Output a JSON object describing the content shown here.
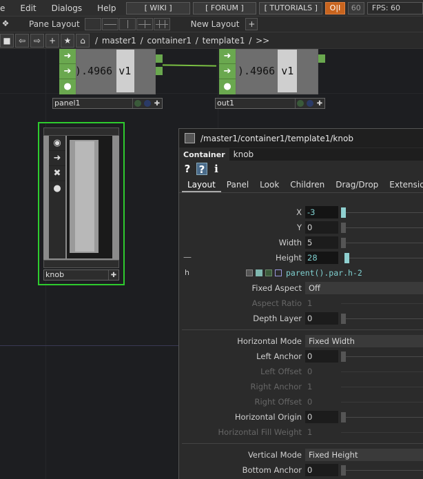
{
  "menubar": {
    "items": [
      "e",
      "Edit",
      "Dialogs",
      "Help"
    ],
    "wiki": "[ WIKI ]",
    "forum": "[ FORUM ]",
    "tutorials": "[ TUTORIALS ]",
    "oi": "O|I",
    "fps_cap": "60",
    "fps": "FPS:  60"
  },
  "panebar": {
    "pane_layout": "Pane Layout",
    "new_layout": "New Layout",
    "plus": "+"
  },
  "pathbar": {
    "path": "/ master1 / container1 / template1 / >>"
  },
  "nodes": {
    "panel1": {
      "name": "panel1",
      "value": ").4966 v1"
    },
    "out1": {
      "name": "out1",
      "value": ").4966 v1"
    },
    "knob": {
      "name": "knob"
    }
  },
  "param_panel": {
    "title": "/master1/container1/template1/knob",
    "type": "Container",
    "op_name": "knob",
    "help": [
      "?",
      "?",
      "i"
    ],
    "tabs": [
      "Layout",
      "Panel",
      "Look",
      "Children",
      "Drag/Drop",
      "Extensions"
    ],
    "params": {
      "x": {
        "label": "X",
        "value": "-3"
      },
      "y": {
        "label": "Y",
        "value": "0"
      },
      "width": {
        "label": "Width",
        "value": "5"
      },
      "height": {
        "label": "Height",
        "value": "28"
      },
      "h_expr_label": "h",
      "h_expr": "parent().par.h-2",
      "fixed_aspect": {
        "label": "Fixed Aspect",
        "value": "Off"
      },
      "aspect_ratio": {
        "label": "Aspect Ratio",
        "value": "1"
      },
      "depth_layer": {
        "label": "Depth Layer",
        "value": "0"
      },
      "horizontal_mode": {
        "label": "Horizontal Mode",
        "value": "Fixed Width"
      },
      "left_anchor": {
        "label": "Left Anchor",
        "value": "0"
      },
      "left_offset": {
        "label": "Left Offset",
        "value": "0"
      },
      "right_anchor": {
        "label": "Right Anchor",
        "value": "1"
      },
      "right_offset": {
        "label": "Right Offset",
        "value": "0"
      },
      "horizontal_origin": {
        "label": "Horizontal Origin",
        "value": "0"
      },
      "horizontal_fill_weight": {
        "label": "Horizontal Fill Weight",
        "value": "1"
      },
      "vertical_mode": {
        "label": "Vertical Mode",
        "value": "Fixed Height"
      },
      "bottom_anchor": {
        "label": "Bottom Anchor",
        "value": "0"
      }
    }
  },
  "colors": {
    "accent_orange": "#c8641e",
    "node_green": "#6aa84f",
    "selection_green": "#2ecc2e",
    "value_cyan": "#7fd0d0"
  }
}
